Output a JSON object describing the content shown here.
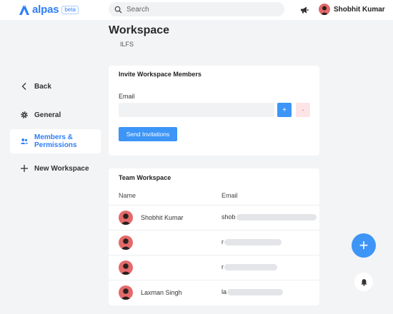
{
  "app": {
    "name": "alpas",
    "badge": "beta"
  },
  "search": {
    "placeholder": "Search"
  },
  "user": {
    "name": "Shobhit Kumar"
  },
  "page": {
    "title": "Workspace",
    "subtitle": "ILFS"
  },
  "sidebar": {
    "items": [
      {
        "label": "Back",
        "icon": "chevron-left-icon"
      },
      {
        "label": "General",
        "icon": "gear-icon"
      },
      {
        "label": "Members & Permissions",
        "icon": "users-icon",
        "active": true
      },
      {
        "label": "New Workspace",
        "icon": "plus-icon"
      }
    ]
  },
  "invite": {
    "title": "Invite Workspace Members",
    "email_label": "Email",
    "email_value": "",
    "add_label": "+",
    "remove_label": "-",
    "send_label": "Send Invitations"
  },
  "team": {
    "title": "Team Workspace",
    "columns": [
      "Name",
      "Email"
    ],
    "rows": [
      {
        "name": "Shobhit Kumar",
        "email_prefix": "shob"
      },
      {
        "name": "",
        "email_prefix": "r"
      },
      {
        "name": "",
        "email_prefix": "r"
      },
      {
        "name": "Laxman Singh",
        "email_prefix": "la"
      }
    ]
  },
  "floating": {
    "add_label": "+"
  },
  "colors": {
    "accent": "#3d95f7",
    "brand": "#2d7ff9",
    "avatar": "#e46a6a",
    "danger_bg": "#fde4e6"
  }
}
